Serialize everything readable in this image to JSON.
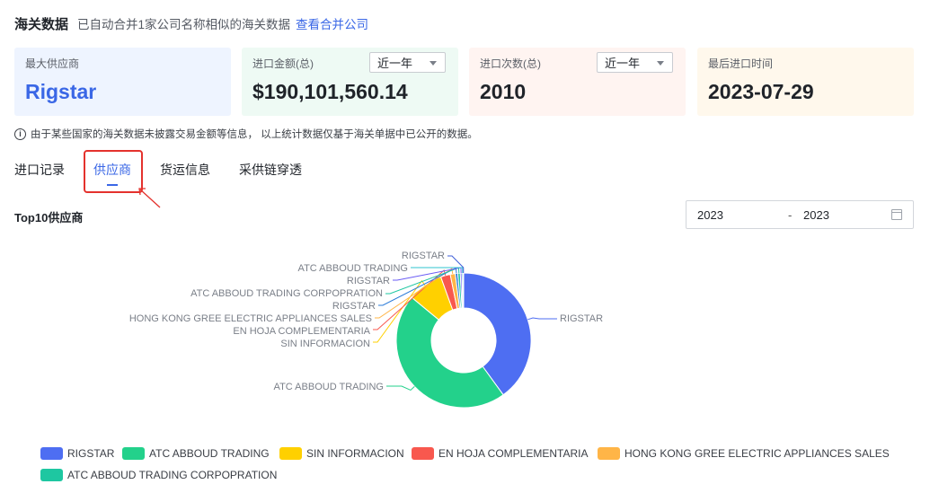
{
  "header": {
    "title": "海关数据",
    "desc": "已自动合并1家公司名称相似的海关数据",
    "link": "查看合并公司"
  },
  "cards": [
    {
      "label": "最大供应商",
      "value": "Rigstar",
      "bg": "#eef4ff",
      "value_color": "#3a67e6"
    },
    {
      "label": "进口金额(总)",
      "value": "$190,101,560.14",
      "select": "近一年",
      "bg": "#eefaf4"
    },
    {
      "label": "进口次数(总)",
      "value": "2010",
      "select": "近一年",
      "bg": "#fff4f1"
    },
    {
      "label": "最后进口时间",
      "value": "2023-07-29",
      "bg": "#fff8ec"
    }
  ],
  "notice": "由于某些国家的海关数据未披露交易金额等信息， 以上统计数据仅基于海关单据中已公开的数据。",
  "tabs": [
    "进口记录",
    "供应商",
    "货运信息",
    "采供链穿透"
  ],
  "active_tab": "供应商",
  "section_title": "Top10供应商",
  "date_range": {
    "start": "2023",
    "separator": "-",
    "end": "2023"
  },
  "chart_data": {
    "type": "pie",
    "style": "donut",
    "series": [
      {
        "name": "RIGSTAR",
        "value": 40.0,
        "color": "#4e6ef2"
      },
      {
        "name": "ATC ABBOUD TRADING",
        "value": 46.0,
        "color": "#23d18b"
      },
      {
        "name": "SIN INFORMACION",
        "value": 8.5,
        "color": "#ffd000"
      },
      {
        "name": "EN HOJA COMPLEMENTARIA",
        "value": 2.3,
        "color": "#f8584e"
      },
      {
        "name": "HONG KONG GREE ELECTRIC APPLIANCES SALES",
        "value": 1.2,
        "color": "#ffb547"
      },
      {
        "name": "RIGSTAR",
        "value": 0.6,
        "color": "#2b7bd8"
      },
      {
        "name": "ATC ABBOUD TRADING CORPOPRATION",
        "value": 0.6,
        "color": "#1ec7a1"
      },
      {
        "name": "RIGSTAR",
        "value": 0.4,
        "color": "#6a5cf5"
      },
      {
        "name": "ATC ABBOUD TRADING",
        "value": 0.3,
        "color": "#2fc4cf"
      },
      {
        "name": "RIGSTAR",
        "value": 0.1,
        "color": "#3f5fd8"
      }
    ],
    "legend": [
      {
        "name": "RIGSTAR",
        "color": "#4e6ef2"
      },
      {
        "name": "ATC ABBOUD TRADING",
        "color": "#23d18b"
      },
      {
        "name": "SIN INFORMACION",
        "color": "#ffd000"
      },
      {
        "name": "EN HOJA COMPLEMENTARIA",
        "color": "#f8584e"
      },
      {
        "name": "HONG KONG GREE ELECTRIC APPLIANCES SALES",
        "color": "#ffb547"
      },
      {
        "name": "ATC ABBOUD TRADING CORPOPRATION",
        "color": "#1ec7a1"
      }
    ],
    "legend_position": "bottom-left"
  }
}
